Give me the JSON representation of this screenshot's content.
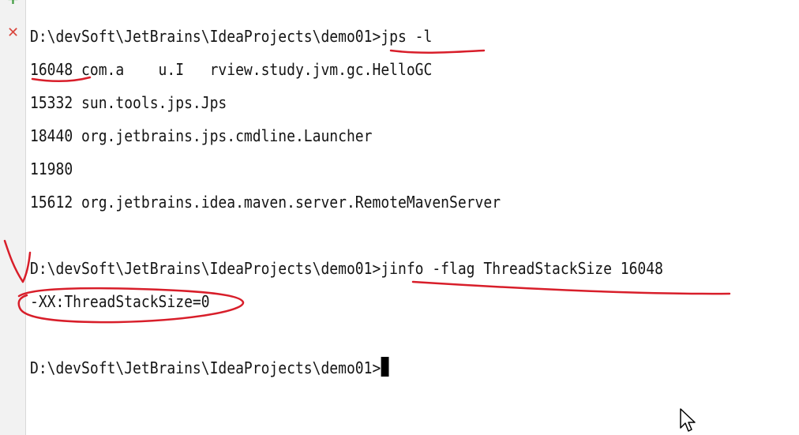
{
  "gutter": {
    "add_icon": "+",
    "close_icon": "✕"
  },
  "terminal": {
    "lines": [
      "D:\\devSoft\\JetBrains\\IdeaProjects\\demo01>jps -l",
      "16048 com.a    u.I   rview.study.jvm.gc.HelloGC",
      "15332 sun.tools.jps.Jps",
      "18440 org.jetbrains.jps.cmdline.Launcher",
      "11980",
      "15612 org.jetbrains.idea.maven.server.RemoteMavenServer",
      "",
      "D:\\devSoft\\JetBrains\\IdeaProjects\\demo01>jinfo -flag ThreadStackSize 16048",
      "-XX:ThreadStackSize=0",
      "",
      "D:\\devSoft\\JetBrains\\IdeaProjects\\demo01>"
    ]
  },
  "colors": {
    "annotation": "#d81e2a",
    "add_icon": "#3f9b3f",
    "close_icon": "#d9463d"
  }
}
